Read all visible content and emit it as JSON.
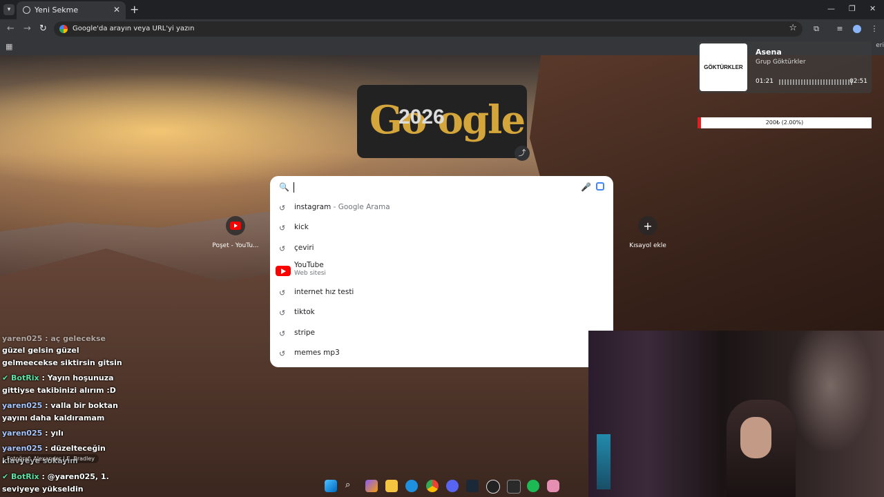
{
  "browser": {
    "tab_title": "Yeni Sekme",
    "omnibox_placeholder": "Google'da arayın veya URL'yi yazın",
    "bookmarks_right": "eri"
  },
  "shortcuts": [
    {
      "label": "Poşet - YouTu..."
    },
    {
      "label": "Kısayol ekle"
    }
  ],
  "suggestions": [
    {
      "text": "instagram",
      "sub": " - Google Arama"
    },
    {
      "text": "kick"
    },
    {
      "text": "çeviri"
    },
    {
      "text": "YouTube",
      "sub": "Web sitesi"
    },
    {
      "text": "internet hız testi"
    },
    {
      "text": "tiktok"
    },
    {
      "text": "stripe"
    },
    {
      "text": "memes mp3"
    }
  ],
  "music": {
    "album_art": "GÖKTÜRKLER",
    "song": "Asena",
    "artist": "Grup Göktürkler",
    "elapsed": "01:21",
    "duration": "02:51",
    "progress": 0.47
  },
  "donation": {
    "label": "200₺ (2.00%)",
    "fraction": 0.02
  },
  "chat": [
    {
      "text": "yaren025 : aç gelecekse"
    },
    {
      "text": "güzel gelsin güzel"
    },
    {
      "text": "gelmeecekse siktirsin gitsin"
    },
    {
      "user": "BotRix",
      "msg": ": Yayın hoşunuza"
    },
    {
      "text": "gittiyse takibinizi alırım :D"
    },
    {
      "user": "yaren025",
      "msg": ": valla bir boktan"
    },
    {
      "text": "yayını daha kaldıramam"
    },
    {
      "user": "yaren025",
      "msg": ": yılı"
    },
    {
      "user": "yaren025",
      "msg": ": düzelteceğin"
    },
    {
      "text": "klavyeye sokayım"
    },
    {
      "user": "BotRix",
      "msg": ": @yaren025, 1."
    },
    {
      "text": "seviyeye yükseldin"
    }
  ],
  "photo_credit": "Fotoğraf: Alexander J.E. Bradley",
  "colors": {
    "accent": "#4285f4",
    "youtube": "#ff0000",
    "bot": "#5ce1a6",
    "user": "#a9c8ff"
  }
}
